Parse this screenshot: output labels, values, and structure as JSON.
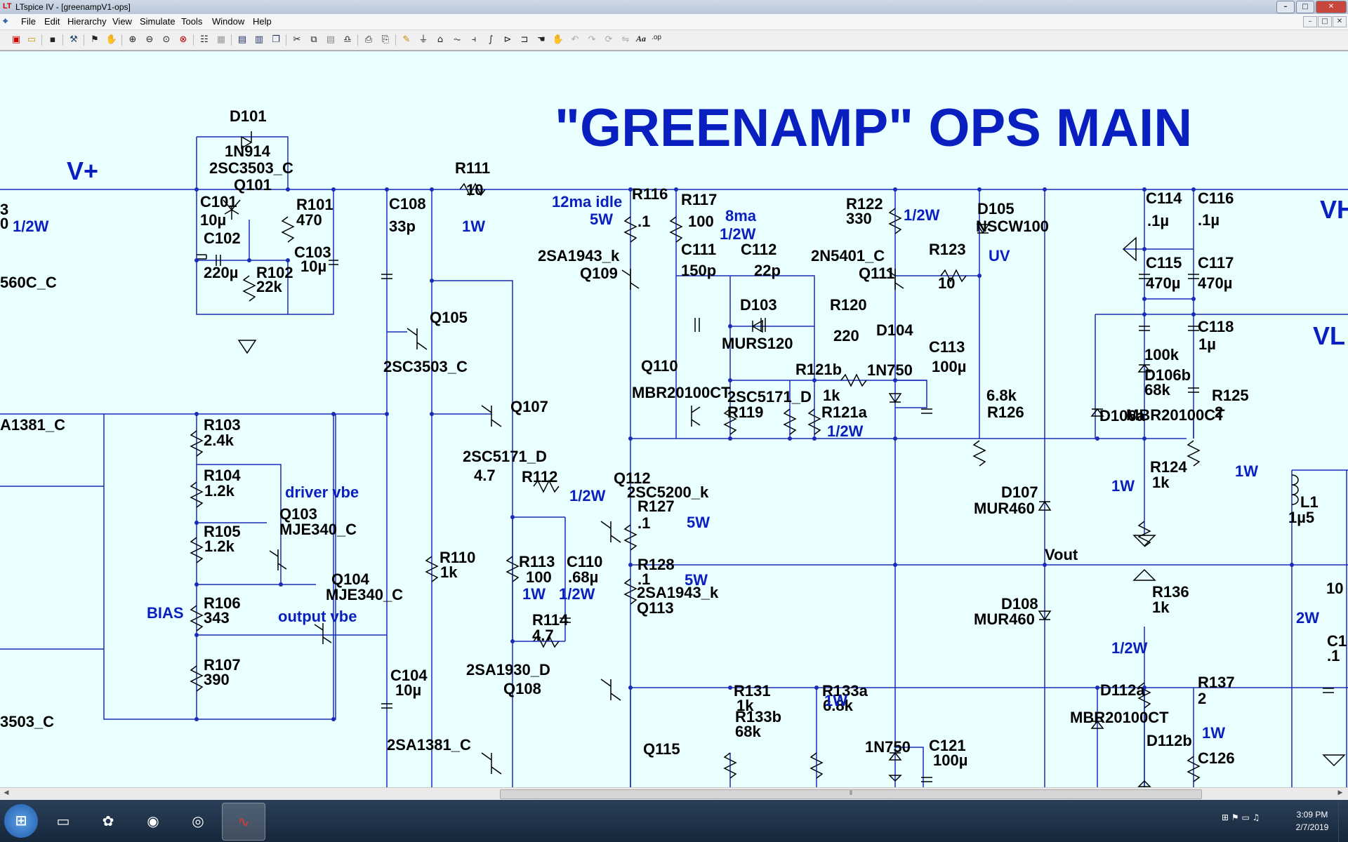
{
  "window": {
    "title": "LTspice IV - [greenampV1-ops]",
    "min": "–",
    "max": "□",
    "close": "✕"
  },
  "menu": [
    "File",
    "Edit",
    "Hierarchy",
    "View",
    "Simulate",
    "Tools",
    "Window",
    "Help"
  ],
  "toolbar_icons": [
    "new-schematic-icon",
    "open-icon",
    "save-icon",
    "control-panel-icon",
    "run-icon",
    "halt-icon",
    "zoom-in-icon",
    "zoom-out-icon",
    "zoom-fit-icon",
    "zoom-cancel-icon",
    "autorange-icon",
    "grid-icon",
    "tile-horizontal-icon",
    "tile-vertical-icon",
    "cascade-icon",
    "cut-icon",
    "copy-icon",
    "paste-icon",
    "find-icon",
    "print-icon",
    "print-preview-icon",
    "draw-wire-icon",
    "ground-icon",
    "label-net-icon",
    "resistor-icon",
    "capacitor-icon",
    "inductor-icon",
    "diode-icon",
    "component-icon",
    "move-icon",
    "drag-icon",
    "undo-icon",
    "redo-icon",
    "rotate-icon",
    "mirror-icon",
    "text-icon",
    "spice-directive-icon"
  ],
  "toolbar_labels": {
    "text": "Aa",
    "directive": ".op"
  },
  "schematic": {
    "title": "\"GREENAMP\" OPS MAIN",
    "rails": [
      "V+",
      "VH",
      "VL",
      "Vout"
    ],
    "notes_blue": [
      "1/2W",
      "1W",
      "12ma idle",
      "5W",
      "8ma",
      "1/2W",
      "1/2W",
      "UV",
      "driver vbe",
      "output vbe",
      "BIAS",
      "1/2W",
      "1/2W",
      "5W",
      "5W",
      "1W",
      "1/2W",
      "1W",
      "1W",
      "1W",
      "1/2W",
      "1W",
      "2W"
    ],
    "labels": [
      "D101",
      "1N914",
      "2SC3503_C",
      "Q101",
      "C101",
      "10µ",
      "R101",
      "470",
      "C102",
      "220µ",
      "R102",
      "22k",
      "C103",
      "10µ",
      "C108",
      "33p",
      "R111",
      "10",
      "R116",
      ".1",
      "R117",
      "100",
      "C111",
      "150p",
      "C112",
      "22p",
      "R122",
      "330",
      "D105",
      "NSCW100",
      "C114",
      ".1µ",
      "C115",
      "470µ",
      "C116",
      ".1µ",
      "C117",
      "470µ",
      "2SA1943_k",
      "Q109",
      "2N5401_C",
      "Q111",
      "R123",
      "10",
      "D103",
      "MURS120",
      "R120",
      "220",
      "D104",
      "1N750",
      "C113",
      "100µ",
      "C118",
      "1µ",
      "Q105",
      "2SC3503_C",
      "Q110",
      "R121b",
      "100k",
      "D106b",
      "MBR20100CT",
      "2SC5171_D",
      "R119",
      "1k",
      "R121a",
      "6.8k",
      "R126",
      "68k",
      "D106a",
      "MBR20100CT",
      "R125",
      "2",
      "Q107",
      "R103",
      "2.4k",
      "2SC5171_D",
      "R112",
      "4.7",
      "Q112",
      "2SC5200_k",
      "R124",
      "1k",
      "R104",
      "1.2k",
      "D107",
      "MUR460",
      "L1",
      "1µ5",
      "Q103",
      "MJE340_C",
      "R127",
      ".1",
      "R105",
      "1.2k",
      "R113",
      "100",
      "C110",
      ".68µ",
      "Q104",
      "MJE340_C",
      "R110",
      "1k",
      "R128",
      ".1",
      "R106",
      "343",
      "R114",
      "4.7",
      "D108",
      "MUR460",
      "R136",
      "1k",
      "2SA1943_k",
      "Q113",
      "C104",
      "10µ",
      "R107",
      "390",
      "2SA1930_D",
      "Q108",
      "R131",
      "1k",
      "R133a",
      "6.8k",
      "D112a",
      "R137",
      "2",
      "MBR20100CT",
      "R133b",
      "68k",
      "2SA1381_C",
      "Q115",
      "1N750",
      "C121",
      "100µ",
      "D112b",
      "C126",
      "3",
      "560C_C",
      "A1381_C",
      "3503_C",
      "0",
      "10",
      "C1",
      ".1"
    ]
  },
  "status": {
    "scroll_grip": "⦀"
  },
  "taskbar": {
    "start": "⊞",
    "apps": [
      "file-explorer-icon",
      "paint-icon",
      "firefox-icon",
      "chrome-icon",
      "ltspice-icon"
    ],
    "time": "3:09 PM",
    "date": "2/7/2019"
  }
}
